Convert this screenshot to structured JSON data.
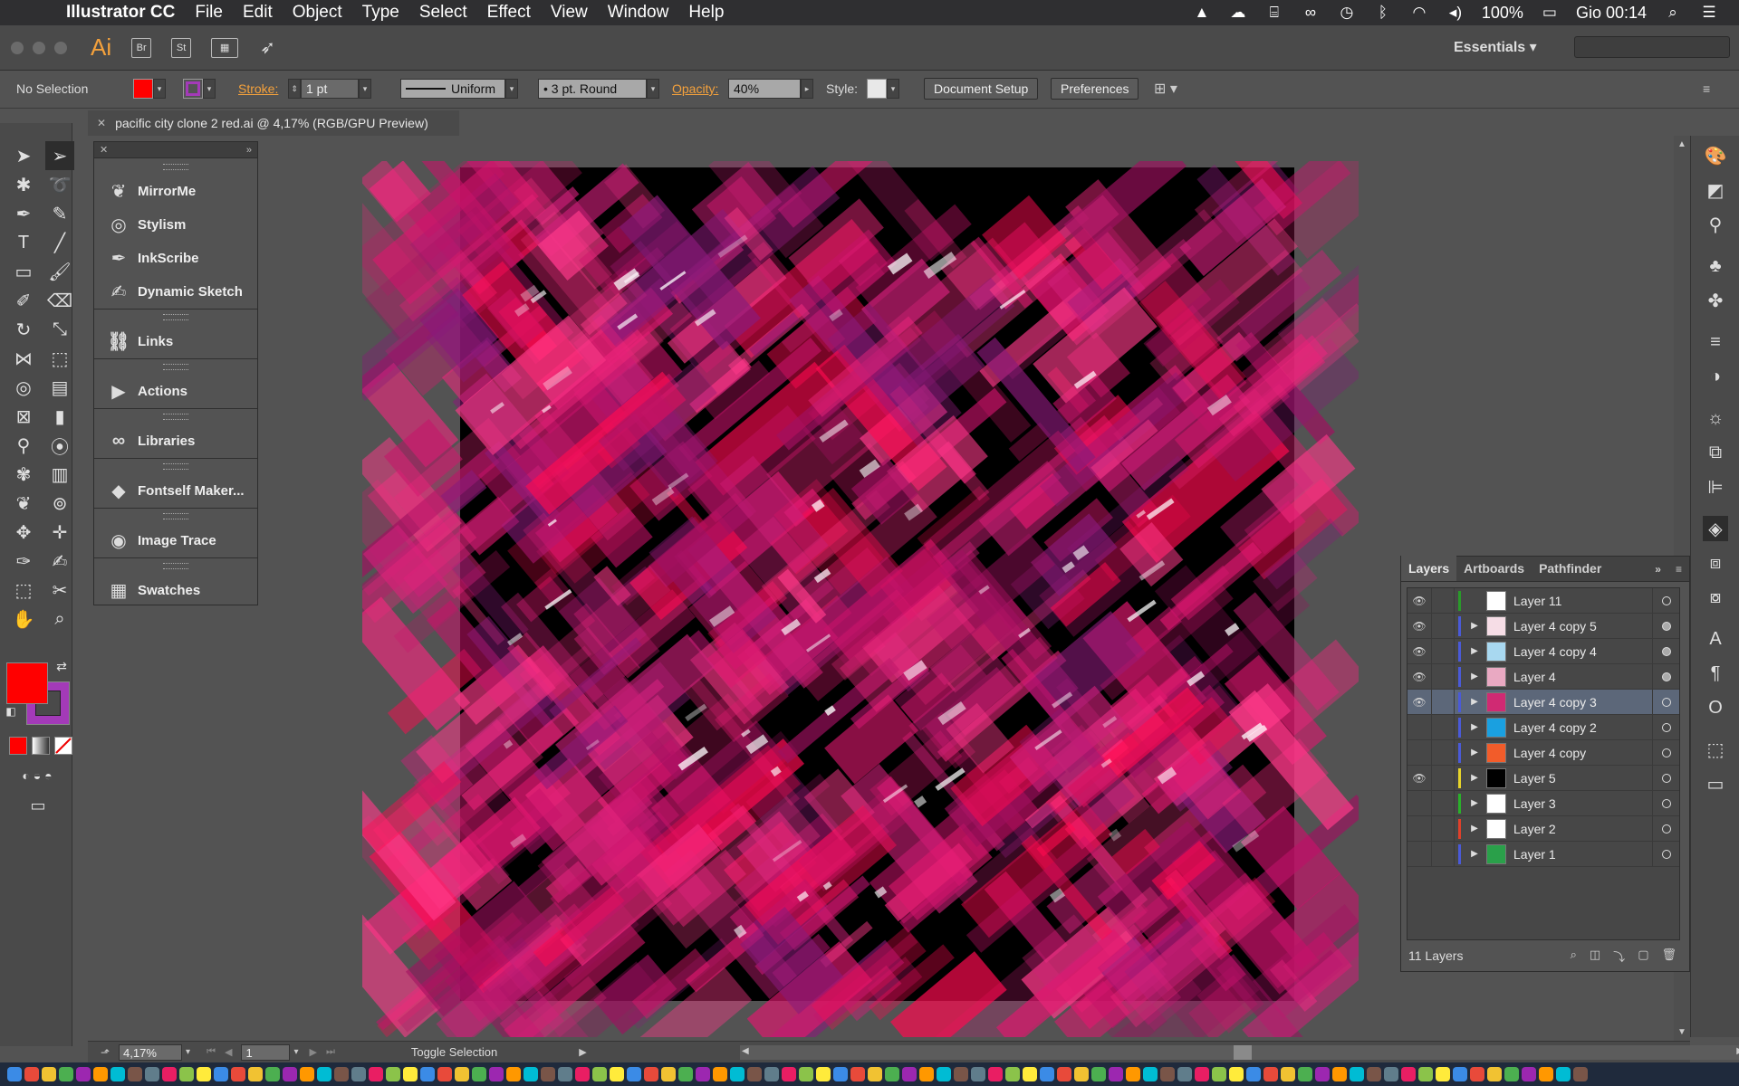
{
  "menubar": {
    "app_name": "Illustrator CC",
    "menus": [
      "File",
      "Edit",
      "Object",
      "Type",
      "Select",
      "Effect",
      "View",
      "Window",
      "Help"
    ],
    "battery": "100%",
    "clock": "Gio 00:14"
  },
  "appbar": {
    "logo": "Ai",
    "bridge": "Br",
    "stock": "St",
    "workspace": "Essentials"
  },
  "control": {
    "selection": "No Selection",
    "stroke_label": "Stroke:",
    "stroke_weight": "1 pt",
    "profile": "Uniform",
    "brush": "3 pt. Round",
    "opacity_label": "Opacity:",
    "opacity_value": "40%",
    "style_label": "Style:",
    "doc_setup": "Document Setup",
    "preferences": "Preferences"
  },
  "document": {
    "tab_title": "pacific city clone 2 red.ai @ 4,17% (RGB/GPU Preview)"
  },
  "plugins": [
    {
      "label": "MirrorMe",
      "icon": "butterfly-icon"
    },
    {
      "label": "Stylism",
      "icon": "spiral-icon"
    },
    {
      "label": "InkScribe",
      "icon": "pen-nib-icon"
    },
    {
      "label": "Dynamic Sketch",
      "icon": "feather-icon"
    },
    {
      "label": "Links",
      "icon": "link-icon"
    },
    {
      "label": "Actions",
      "icon": "play-icon"
    },
    {
      "label": "Libraries",
      "icon": "creative-cloud-icon"
    },
    {
      "label": "Fontself Maker...",
      "icon": "fontself-icon"
    },
    {
      "label": "Image Trace",
      "icon": "image-trace-icon"
    },
    {
      "label": "Swatches",
      "icon": "swatches-grid-icon"
    }
  ],
  "layers_panel": {
    "tabs": [
      "Layers",
      "Artboards",
      "Pathfinder"
    ],
    "layers": [
      {
        "name": "Layer 11",
        "visible": true,
        "expandable": false,
        "color": "#2a9a2a",
        "thumb": "#ffffff",
        "targeted": false
      },
      {
        "name": "Layer 4 copy 5",
        "visible": true,
        "expandable": true,
        "color": "#4a5ad8",
        "thumb": "#f6dde6",
        "targeted": true
      },
      {
        "name": "Layer 4 copy 4",
        "visible": true,
        "expandable": true,
        "color": "#4a5ad8",
        "thumb": "#a8d8f0",
        "targeted": true
      },
      {
        "name": "Layer 4",
        "visible": true,
        "expandable": true,
        "color": "#4a5ad8",
        "thumb": "#e9a9c2",
        "targeted": true
      },
      {
        "name": "Layer 4 copy 3",
        "visible": true,
        "expandable": true,
        "color": "#4a5ad8",
        "thumb": "#d02a73",
        "targeted": false,
        "selected": true
      },
      {
        "name": "Layer 4 copy 2",
        "visible": false,
        "expandable": true,
        "color": "#4a5ad8",
        "thumb": "#1aa0e0",
        "targeted": false
      },
      {
        "name": "Layer 4 copy",
        "visible": false,
        "expandable": true,
        "color": "#4a5ad8",
        "thumb": "#f25c2a",
        "targeted": false
      },
      {
        "name": "Layer 5",
        "visible": true,
        "expandable": true,
        "color": "#e6d42a",
        "thumb": "#000000",
        "targeted": false
      },
      {
        "name": "Layer 3",
        "visible": false,
        "expandable": true,
        "color": "#2ab02a",
        "thumb": "#ffffff",
        "targeted": false
      },
      {
        "name": "Layer 2",
        "visible": false,
        "expandable": true,
        "color": "#e0402a",
        "thumb": "#ffffff",
        "targeted": false
      },
      {
        "name": "Layer 1",
        "visible": false,
        "expandable": true,
        "color": "#4a5ad8",
        "thumb": "#2aa04a",
        "targeted": false
      }
    ],
    "count_label": "11 Layers"
  },
  "status": {
    "zoom": "4,17%",
    "artboard": "1",
    "mode": "Toggle Selection"
  },
  "colors": {
    "fill": "#ff0000",
    "stroke": "#a33ab8",
    "accent_orange": "#f4a13c"
  }
}
